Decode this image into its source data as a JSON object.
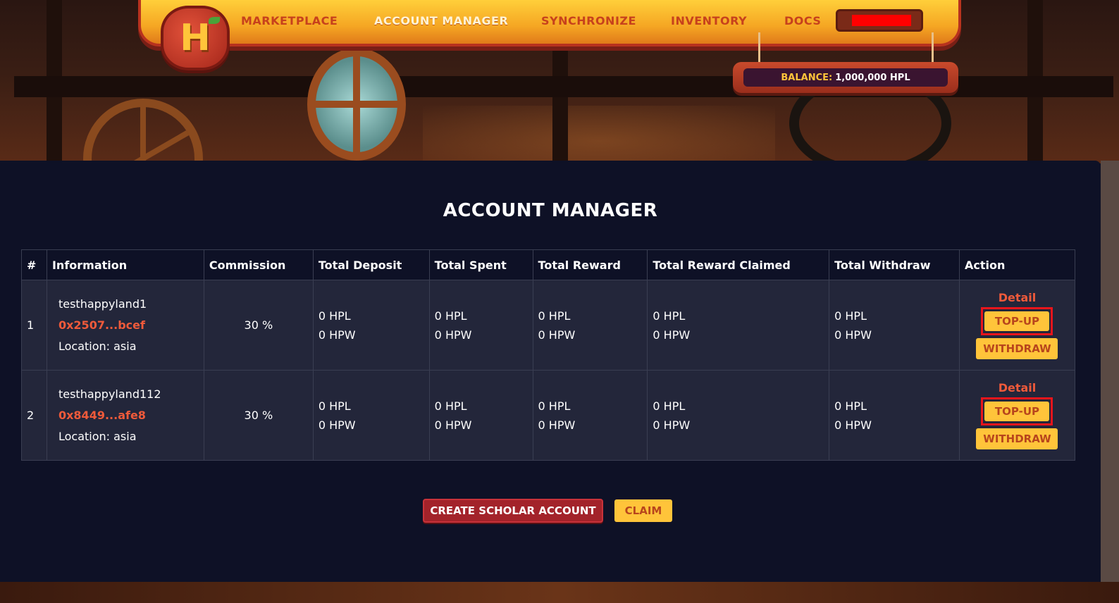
{
  "nav": {
    "logo_letter": "H",
    "items": [
      {
        "label": "MARKETPLACE",
        "active": false
      },
      {
        "label": "ACCOUNT MANAGER",
        "active": true
      },
      {
        "label": "SYNCHRONIZE",
        "active": false
      },
      {
        "label": "INVENTORY",
        "active": false
      },
      {
        "label": "DOCS",
        "active": false
      }
    ]
  },
  "balance": {
    "label": "BALANCE:",
    "value": "1,000,000 HPL"
  },
  "page": {
    "title": "ACCOUNT MANAGER"
  },
  "table": {
    "headers": [
      "#",
      "Information",
      "Commission",
      "Total Deposit",
      "Total Spent",
      "Total Reward",
      "Total Reward Claimed",
      "Total Withdraw",
      "Action"
    ],
    "rows": [
      {
        "index": "1",
        "name": "testhappyland1",
        "address": "0x2507...bcef",
        "location": "Location: asia",
        "commission": "30 %",
        "deposit": [
          "0 HPL",
          "0 HPW"
        ],
        "spent": [
          "0 HPL",
          "0 HPW"
        ],
        "reward": [
          "0 HPL",
          "0 HPW"
        ],
        "reward_claimed": [
          "0 HPL",
          "0 HPW"
        ],
        "withdraw": [
          "0 HPL",
          "0 HPW"
        ],
        "detail": "Detail",
        "topup": "TOP-UP",
        "withdraw_btn": "WITHDRAW"
      },
      {
        "index": "2",
        "name": "testhappyland112",
        "address": "0x8449...afe8",
        "location": "Location: asia",
        "commission": "30 %",
        "deposit": [
          "0 HPL",
          "0 HPW"
        ],
        "spent": [
          "0 HPL",
          "0 HPW"
        ],
        "reward": [
          "0 HPL",
          "0 HPW"
        ],
        "reward_claimed": [
          "0 HPL",
          "0 HPW"
        ],
        "withdraw": [
          "0 HPL",
          "0 HPW"
        ],
        "detail": "Detail",
        "topup": "TOP-UP",
        "withdraw_btn": "WITHDRAW"
      }
    ]
  },
  "buttons": {
    "create": "CREATE SCHOLAR ACCOUNT",
    "claim": "CLAIM"
  },
  "colors": {
    "accent_red": "#f05a3a",
    "button_yellow": "#ffc43a",
    "create_red": "#a3232a",
    "highlight_box": "#e8151b",
    "panel_bg": "#0e1126"
  }
}
